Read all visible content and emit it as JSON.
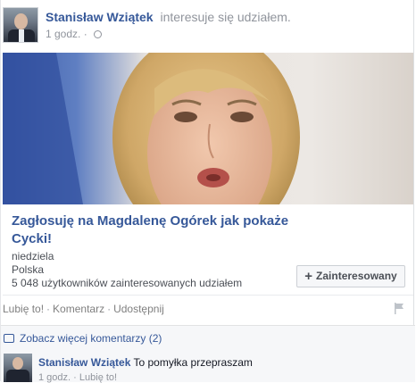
{
  "post": {
    "author": "Stanisław Wziątek",
    "action": "interesuje się udziałem.",
    "time": "1 godz.",
    "separator": "·"
  },
  "event": {
    "title": "Zagłosuję na Magdalenę Ogórek jak pokaże Cycki!",
    "day": "niedziela",
    "location": "Polska",
    "interested": "5 048 użytkowników zainteresowanych udziałem",
    "button_plus": "+",
    "button_label": "Zainteresowany"
  },
  "actions": {
    "like": "Lubię to!",
    "comment": "Komentarz",
    "share": "Udostępnij",
    "sep": "·"
  },
  "comments": {
    "more": "Zobacz więcej komentarzy (2)",
    "items": [
      {
        "author": "Stanisław Wziątek",
        "text": "To pomyłka przepraszam",
        "time": "1 godz.",
        "like": "Lubię to!",
        "sep": "·"
      }
    ]
  },
  "icons": {
    "audience": "globe-icon",
    "report": "flag-icon",
    "comments": "speech-bubble-icon"
  },
  "colors": {
    "link": "#365899",
    "muted": "#90949c",
    "background": "#f6f7f9"
  }
}
